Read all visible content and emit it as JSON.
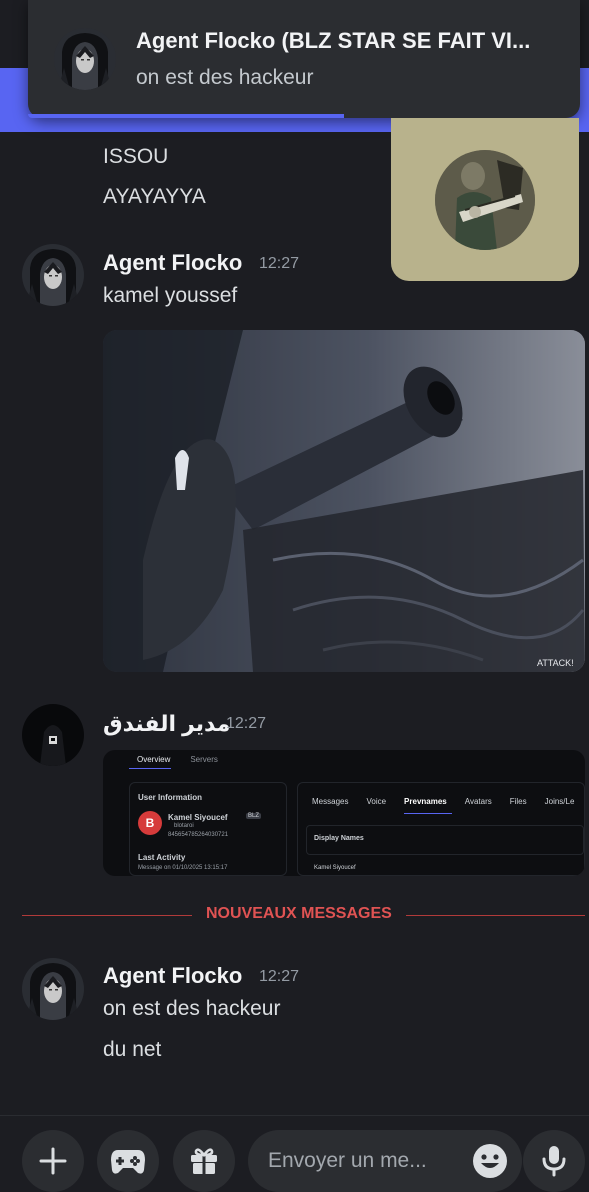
{
  "notification": {
    "title": "Agent Flocko (BLZ STAR SE FAIT VI...",
    "text": "on est des hackeur"
  },
  "messages_top": {
    "line1": "ISSOU",
    "line2": "AYAYAYYA"
  },
  "message1": {
    "author": "Agent Flocko",
    "time": "12:27",
    "text": "kamel youssef",
    "gif_watermark": "ATTACK!"
  },
  "message2": {
    "author": "مدير الفندق",
    "time": "12:27",
    "screenshot": {
      "tab_overview": "Overview",
      "tab_servers": "Servers",
      "section": "User Information",
      "user_name": "Kamel Siyoucef",
      "badge": "BLZ",
      "handle": "blotaroi",
      "user_id": "845654785264030721",
      "last_activity_label": "Last Activity",
      "last_activity_value": "Message on 01/10/2025 13:15:17",
      "tabs": [
        "Messages",
        "Voice",
        "Prevnames",
        "Avatars",
        "Files",
        "Joins/Le"
      ],
      "display_names_label": "Display Names",
      "display_name_value": "Kamel Siyoucef"
    }
  },
  "divider": {
    "label": "NOUVEAUX MESSAGES"
  },
  "message3": {
    "author": "Agent Flocko",
    "time": "12:27",
    "line1": "on est des hackeur",
    "line2": "du net"
  },
  "composer": {
    "placeholder": "Envoyer un me..."
  },
  "colors": {
    "background": "#1c1d22",
    "accent": "#5865f2",
    "new_messages": "#e05353",
    "pip_background": "#b8b28c"
  },
  "icons": [
    "plus-icon",
    "gamepad-icon",
    "gift-icon",
    "emoji-icon",
    "microphone-icon"
  ]
}
